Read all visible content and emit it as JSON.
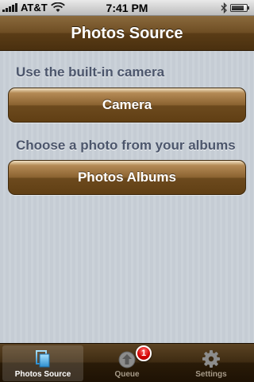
{
  "status_bar": {
    "carrier": "AT&T",
    "time": "7:41 PM",
    "signal_bars": 5,
    "battery_level": 0.85
  },
  "nav": {
    "title": "Photos Source"
  },
  "camera_section": {
    "label": "Use the built-in camera",
    "button_label": "Camera"
  },
  "albums_section": {
    "label": "Choose a photo from your albums",
    "button_label": "Photos Albums"
  },
  "tab_bar": {
    "tabs": [
      {
        "label": "Photos Source",
        "icon": "photos-source-icon",
        "selected": true
      },
      {
        "label": "Queue",
        "icon": "upload-queue-icon",
        "badge": "1",
        "selected": false
      },
      {
        "label": "Settings",
        "icon": "gear-icon",
        "selected": false
      }
    ]
  },
  "colors": {
    "nav_brown": "#6f4e24",
    "button_brown": "#8a6230",
    "label_slate": "#4c566c",
    "badge_red": "#d10000",
    "selected_tab_icon_blue": "#4fb0e8"
  }
}
